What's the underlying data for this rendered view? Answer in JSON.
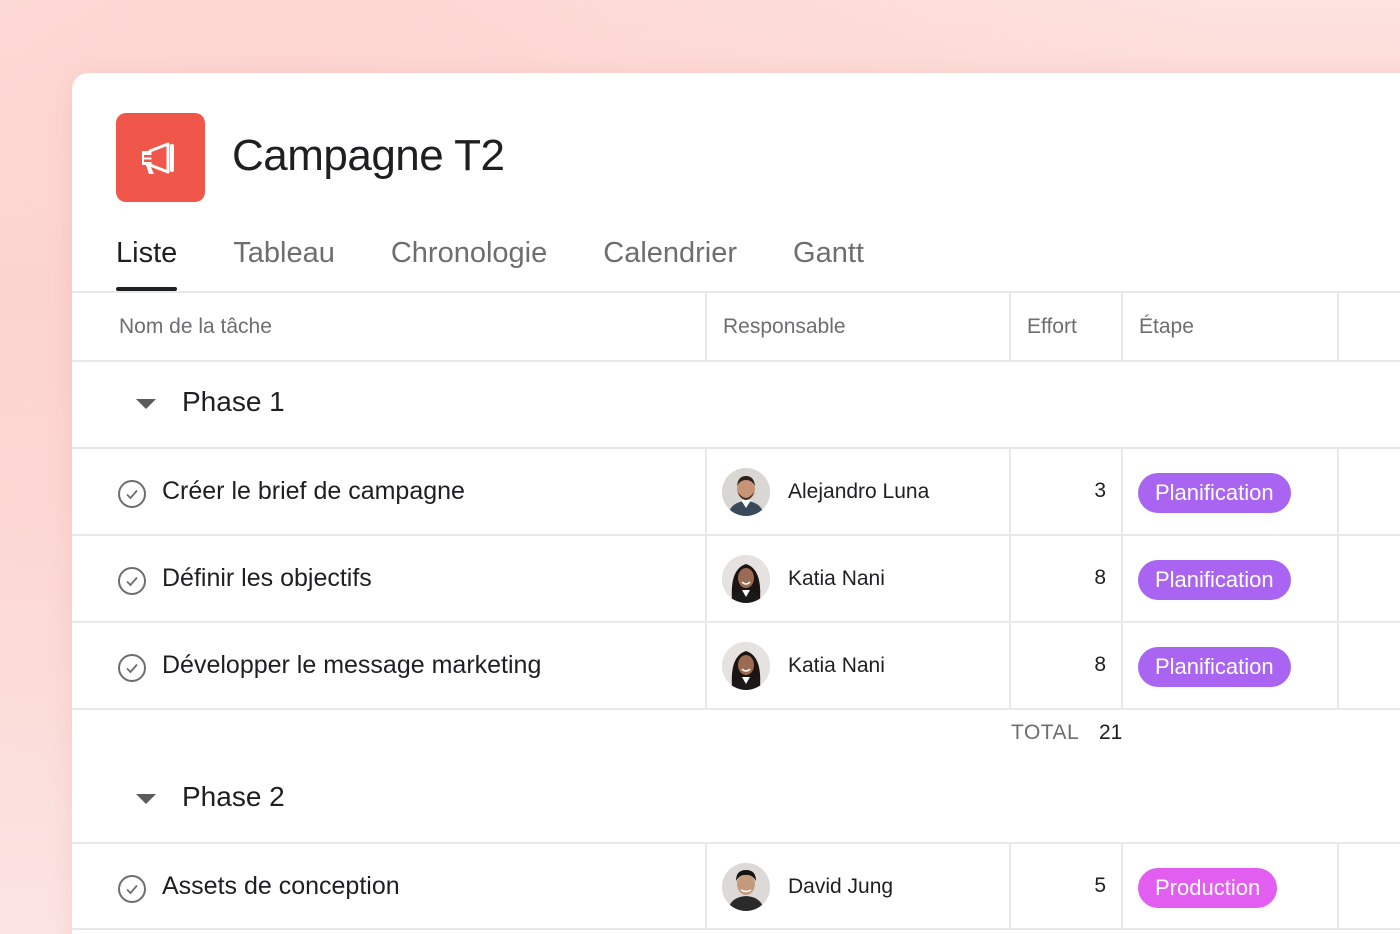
{
  "project": {
    "title": "Campagne T2",
    "icon": "megaphone-icon",
    "icon_color": "#f0574a"
  },
  "tabs": [
    {
      "label": "Liste",
      "active": true
    },
    {
      "label": "Tableau",
      "active": false
    },
    {
      "label": "Chronologie",
      "active": false
    },
    {
      "label": "Calendrier",
      "active": false
    },
    {
      "label": "Gantt",
      "active": false
    }
  ],
  "columns": {
    "task": "Nom de la tâche",
    "assignee": "Responsable",
    "effort": "Effort",
    "stage": "Étape"
  },
  "sections": [
    {
      "name": "Phase 1",
      "tasks": [
        {
          "name": "Créer le brief de campagne",
          "assignee": "Alejandro Luna",
          "effort": "3",
          "stage": "Planification"
        },
        {
          "name": "Définir les objectifs",
          "assignee": "Katia Nani",
          "effort": "8",
          "stage": "Planification"
        },
        {
          "name": "Développer le message marketing",
          "assignee": "Katia Nani",
          "effort": "8",
          "stage": "Planification"
        }
      ],
      "total_label": "TOTAL",
      "total_value": "21"
    },
    {
      "name": "Phase 2",
      "tasks": [
        {
          "name": "Assets de conception",
          "assignee": "David Jung",
          "effort": "5",
          "stage": "Production"
        }
      ]
    }
  ],
  "colors": {
    "planification": "#a965f2",
    "production": "#e15ef0",
    "background": "#fbd2cd"
  }
}
